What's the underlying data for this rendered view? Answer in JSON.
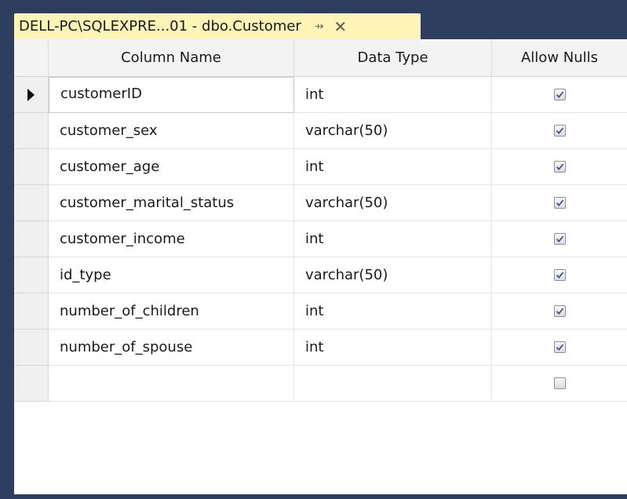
{
  "tab": {
    "title": "DELL-PC\\SQLEXPRE...01 - dbo.Customer",
    "pin_glyph": "⇸",
    "close_glyph": "✕"
  },
  "grid": {
    "headers": {
      "column_name": "Column Name",
      "data_type": "Data Type",
      "allow_nulls": "Allow Nulls"
    },
    "rows": [
      {
        "name": "customerID",
        "type": "int",
        "allow_nulls": true,
        "current": true
      },
      {
        "name": "customer_sex",
        "type": "varchar(50)",
        "allow_nulls": true
      },
      {
        "name": "customer_age",
        "type": "int",
        "allow_nulls": true
      },
      {
        "name": "customer_marital_status",
        "type": "varchar(50)",
        "allow_nulls": true
      },
      {
        "name": "customer_income",
        "type": "int",
        "allow_nulls": true
      },
      {
        "name": "id_type",
        "type": "varchar(50)",
        "allow_nulls": true
      },
      {
        "name": "number_of_children",
        "type": "int",
        "allow_nulls": true
      },
      {
        "name": "number_of_spouse",
        "type": "int",
        "allow_nulls": true
      },
      {
        "name": "",
        "type": "",
        "allow_nulls": false
      }
    ]
  },
  "colors": {
    "tab_active": "#fdf4b6",
    "chrome": "#2e3e60",
    "check": "#3b5a8a"
  },
  "icons": {
    "pin": "pin-icon",
    "close": "close-icon",
    "row_selector": "row-pointer-icon",
    "checkbox": "checkbox-icon"
  }
}
